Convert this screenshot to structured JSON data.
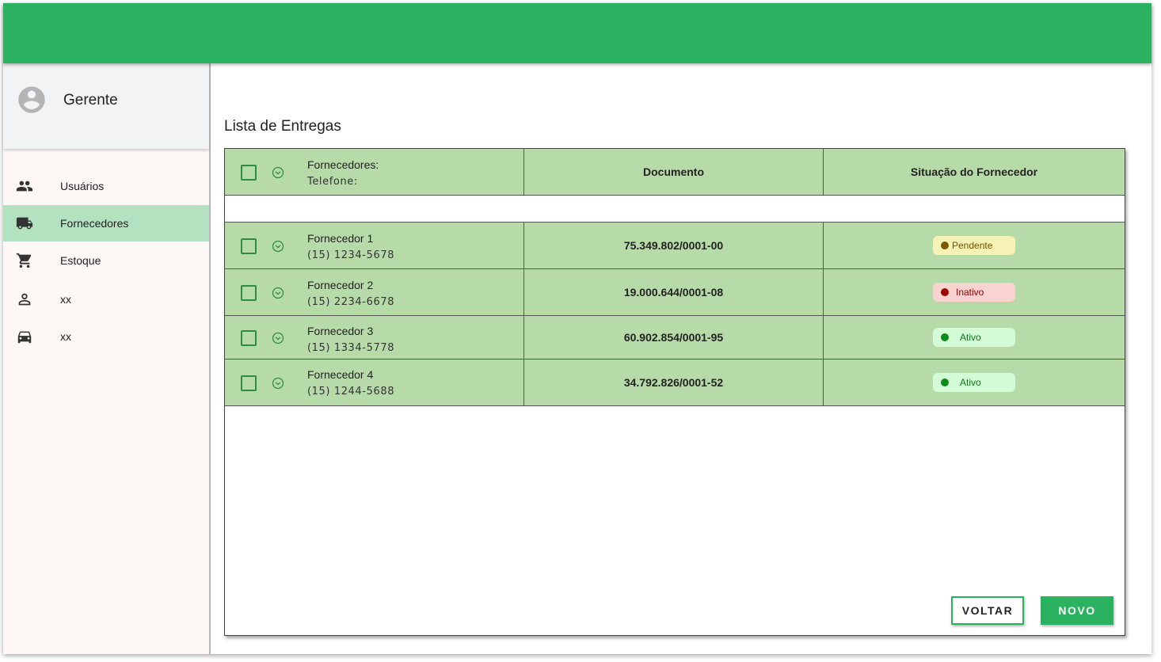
{
  "colors": {
    "brand": "#2bb260",
    "row_bg": "#b7dba8",
    "active_nav": "#b3e2c0",
    "pendente_bg": "#f6f2b6",
    "pendente_dot": "#7a5a00",
    "inativo_bg": "#f8d3d0",
    "inativo_dot": "#9b0000",
    "ativo_bg": "#d2fbd6",
    "ativo_dot": "#0a8a18"
  },
  "sidebar": {
    "profile_name": "Gerente",
    "items": [
      {
        "label": "Usuários",
        "icon": "users-icon"
      },
      {
        "label": "Fornecedores",
        "icon": "truck-icon",
        "active": true
      },
      {
        "label": "Estoque",
        "icon": "cart-icon"
      },
      {
        "label": "xx",
        "icon": "person-icon"
      },
      {
        "label": "xx",
        "icon": "car-icon"
      }
    ]
  },
  "main": {
    "title": "Lista de Entregas",
    "table": {
      "header": {
        "col1_line1": "Fornecedores:",
        "col1_line2": "Telefone:",
        "col2": "Documento",
        "col3": "Situação do Fornecedor"
      },
      "rows": [
        {
          "name": "Fornecedor 1",
          "phone": "(15) 1234-5678",
          "document": "75.349.802/0001-00",
          "status": "Pendente"
        },
        {
          "name": "Fornecedor 2",
          "phone": "(15) 2234-6678",
          "document": "19.000.644/0001-08",
          "status": "Inativo"
        },
        {
          "name": "Fornecedor 3",
          "phone": "(15) 1334-5778",
          "document": "60.902.854/0001-95",
          "status": "Ativo"
        },
        {
          "name": "Fornecedor 4",
          "phone": "(15) 1244-5688",
          "document": "34.792.826/0001-52",
          "status": "Ativo"
        }
      ]
    },
    "buttons": {
      "back": "VOLTAR",
      "new": "NOVO"
    }
  }
}
